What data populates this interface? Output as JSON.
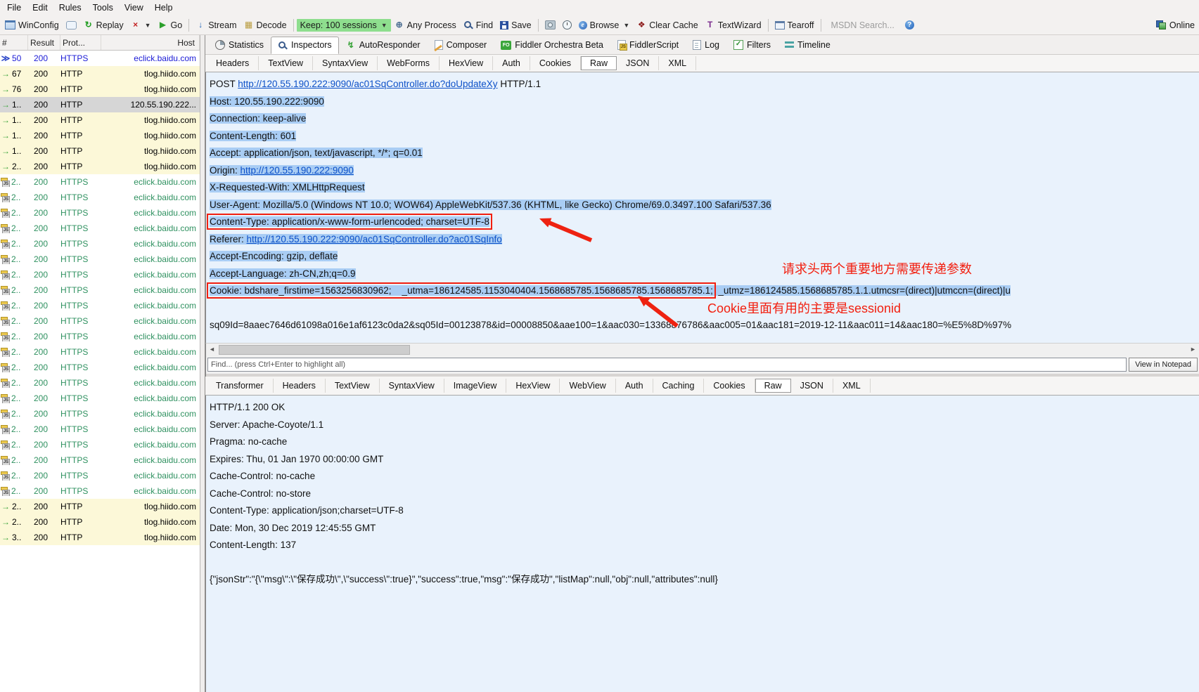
{
  "menu": {
    "items": [
      "File",
      "Edit",
      "Rules",
      "Tools",
      "View",
      "Help"
    ]
  },
  "toolbar": {
    "items": [
      {
        "type": "button",
        "icon": "winconfig-icon",
        "label": "WinConfig"
      },
      {
        "type": "button",
        "icon": "comment-icon",
        "label": ""
      },
      {
        "type": "button",
        "icon": "replay-icon",
        "label": "Replay"
      },
      {
        "type": "button",
        "icon": "remove-x-icon",
        "label": "",
        "caret": true
      },
      {
        "type": "button",
        "icon": "go-icon",
        "label": "Go"
      },
      {
        "type": "separator"
      },
      {
        "type": "button",
        "icon": "stream-icon",
        "label": "Stream"
      },
      {
        "type": "button",
        "icon": "decode-icon",
        "label": "Decode"
      },
      {
        "type": "separator"
      },
      {
        "type": "button",
        "icon": null,
        "label": "Keep: 100 sessions",
        "variant": "keep",
        "caret": true
      },
      {
        "type": "button",
        "icon": "any-process-icon",
        "label": "Any Process"
      },
      {
        "type": "button",
        "icon": "find-icon",
        "label": "Find"
      },
      {
        "type": "button",
        "icon": "save-icon",
        "label": "Save"
      },
      {
        "type": "separator"
      },
      {
        "type": "button",
        "icon": "screenshot-icon",
        "label": ""
      },
      {
        "type": "button",
        "icon": "timer-icon",
        "label": ""
      },
      {
        "type": "button",
        "icon": "browse-icon",
        "label": "Browse",
        "caret": true
      },
      {
        "type": "button",
        "icon": "clear-cache-icon",
        "label": "Clear Cache"
      },
      {
        "type": "button",
        "icon": "text-wizard-icon",
        "label": "TextWizard"
      },
      {
        "type": "separator"
      },
      {
        "type": "button",
        "icon": "tearoff-icon",
        "label": "Tearoff"
      },
      {
        "type": "separator"
      },
      {
        "type": "msdn",
        "label": "MSDN Search..."
      },
      {
        "type": "button",
        "icon": "help-icon",
        "label": ""
      }
    ],
    "online": {
      "icon": "online-icon",
      "label": "Online"
    }
  },
  "session_list": {
    "columns": [
      "#",
      "Result",
      "Prot...",
      "Host"
    ],
    "rows": [
      {
        "icon": "session-selected-icon",
        "num": "50",
        "result": "200",
        "protocol": "HTTPS",
        "host": "eclick.baidu.com",
        "style": "blue"
      },
      {
        "icon": "request-arrow-icon",
        "num": "67",
        "result": "200",
        "protocol": "HTTP",
        "host": "tlog.hiido.com",
        "style": "yellow"
      },
      {
        "icon": "request-arrow-icon",
        "num": "76",
        "result": "200",
        "protocol": "HTTP",
        "host": "tlog.hiido.com",
        "style": "yellow"
      },
      {
        "icon": "request-arrow-icon",
        "num": "1..",
        "result": "200",
        "protocol": "HTTP",
        "host": "120.55.190.222...",
        "style": "selected"
      },
      {
        "icon": "request-arrow-icon",
        "num": "1..",
        "result": "200",
        "protocol": "HTTP",
        "host": "tlog.hiido.com",
        "style": "yellow"
      },
      {
        "icon": "request-arrow-icon",
        "num": "1..",
        "result": "200",
        "protocol": "HTTP",
        "host": "tlog.hiido.com",
        "style": "yellow"
      },
      {
        "icon": "request-arrow-icon",
        "num": "1..",
        "result": "200",
        "protocol": "HTTP",
        "host": "tlog.hiido.com",
        "style": "yellow"
      },
      {
        "icon": "request-arrow-icon",
        "num": "2..",
        "result": "200",
        "protocol": "HTTP",
        "host": "tlog.hiido.com",
        "style": "yellow"
      },
      {
        "icon": "js-icon",
        "num": "2..",
        "result": "200",
        "protocol": "HTTPS",
        "host": "eclick.baidu.com",
        "style": "green"
      },
      {
        "icon": "js-icon",
        "num": "2..",
        "result": "200",
        "protocol": "HTTPS",
        "host": "eclick.baidu.com",
        "style": "green"
      },
      {
        "icon": "js-icon",
        "num": "2..",
        "result": "200",
        "protocol": "HTTPS",
        "host": "eclick.baidu.com",
        "style": "green"
      },
      {
        "icon": "js-icon",
        "num": "2..",
        "result": "200",
        "protocol": "HTTPS",
        "host": "eclick.baidu.com",
        "style": "green"
      },
      {
        "icon": "js-icon",
        "num": "2..",
        "result": "200",
        "protocol": "HTTPS",
        "host": "eclick.baidu.com",
        "style": "green"
      },
      {
        "icon": "js-icon",
        "num": "2..",
        "result": "200",
        "protocol": "HTTPS",
        "host": "eclick.baidu.com",
        "style": "green"
      },
      {
        "icon": "js-icon",
        "num": "2..",
        "result": "200",
        "protocol": "HTTPS",
        "host": "eclick.baidu.com",
        "style": "green"
      },
      {
        "icon": "js-icon",
        "num": "2..",
        "result": "200",
        "protocol": "HTTPS",
        "host": "eclick.baidu.com",
        "style": "green"
      },
      {
        "icon": "js-icon",
        "num": "2..",
        "result": "200",
        "protocol": "HTTPS",
        "host": "eclick.baidu.com",
        "style": "green"
      },
      {
        "icon": "js-icon",
        "num": "2..",
        "result": "200",
        "protocol": "HTTPS",
        "host": "eclick.baidu.com",
        "style": "green"
      },
      {
        "icon": "js-icon",
        "num": "2..",
        "result": "200",
        "protocol": "HTTPS",
        "host": "eclick.baidu.com",
        "style": "green"
      },
      {
        "icon": "js-icon",
        "num": "2..",
        "result": "200",
        "protocol": "HTTPS",
        "host": "eclick.baidu.com",
        "style": "green"
      },
      {
        "icon": "js-icon",
        "num": "2..",
        "result": "200",
        "protocol": "HTTPS",
        "host": "eclick.baidu.com",
        "style": "green"
      },
      {
        "icon": "js-icon",
        "num": "2..",
        "result": "200",
        "protocol": "HTTPS",
        "host": "eclick.baidu.com",
        "style": "green"
      },
      {
        "icon": "js-icon",
        "num": "2..",
        "result": "200",
        "protocol": "HTTPS",
        "host": "eclick.baidu.com",
        "style": "green"
      },
      {
        "icon": "js-icon",
        "num": "2..",
        "result": "200",
        "protocol": "HTTPS",
        "host": "eclick.baidu.com",
        "style": "green"
      },
      {
        "icon": "js-icon",
        "num": "2..",
        "result": "200",
        "protocol": "HTTPS",
        "host": "eclick.baidu.com",
        "style": "green"
      },
      {
        "icon": "js-icon",
        "num": "2..",
        "result": "200",
        "protocol": "HTTPS",
        "host": "eclick.baidu.com",
        "style": "green"
      },
      {
        "icon": "js-icon",
        "num": "2..",
        "result": "200",
        "protocol": "HTTPS",
        "host": "eclick.baidu.com",
        "style": "green"
      },
      {
        "icon": "js-icon",
        "num": "2..",
        "result": "200",
        "protocol": "HTTPS",
        "host": "eclick.baidu.com",
        "style": "green"
      },
      {
        "icon": "js-icon",
        "num": "2..",
        "result": "200",
        "protocol": "HTTPS",
        "host": "eclick.baidu.com",
        "style": "green"
      },
      {
        "icon": "request-arrow-icon",
        "num": "2..",
        "result": "200",
        "protocol": "HTTP",
        "host": "tlog.hiido.com",
        "style": "yellow"
      },
      {
        "icon": "request-arrow-icon",
        "num": "2..",
        "result": "200",
        "protocol": "HTTP",
        "host": "tlog.hiido.com",
        "style": "yellow"
      },
      {
        "icon": "request-arrow-icon",
        "num": "3..",
        "result": "200",
        "protocol": "HTTP",
        "host": "tlog.hiido.com",
        "style": "yellow"
      }
    ]
  },
  "main_tabs": [
    {
      "icon": "statistics-icon",
      "label": "Statistics",
      "active": false
    },
    {
      "icon": "inspectors-icon",
      "label": "Inspectors",
      "active": true
    },
    {
      "icon": "autoresponder-icon",
      "label": "AutoResponder",
      "active": false
    },
    {
      "icon": "composer-icon",
      "label": "Composer",
      "active": false
    },
    {
      "icon": "orchestra-icon",
      "label": "Fiddler Orchestra Beta",
      "active": false
    },
    {
      "icon": "fiddlerscript-icon",
      "label": "FiddlerScript",
      "active": false
    },
    {
      "icon": "log-icon",
      "label": "Log",
      "active": false
    },
    {
      "icon": "filters-icon",
      "label": "Filters",
      "active": false
    },
    {
      "icon": "timeline-icon",
      "label": "Timeline",
      "active": false
    }
  ],
  "request_inspector": {
    "tabs": [
      {
        "label": "Headers"
      },
      {
        "label": "TextView"
      },
      {
        "label": "SyntaxView"
      },
      {
        "label": "WebForms"
      },
      {
        "label": "HexView"
      },
      {
        "label": "Auth"
      },
      {
        "label": "Cookies"
      },
      {
        "label": "Raw",
        "active": true
      },
      {
        "label": "JSON"
      },
      {
        "label": "XML"
      }
    ],
    "raw_lines": [
      {
        "hl": false,
        "segments": [
          {
            "text": "POST "
          },
          {
            "text": "http://120.55.190.222:9090/ac01SqController.do?doUpdateXy",
            "link": true
          },
          {
            "text": " HTTP/1.1"
          }
        ]
      },
      {
        "hl": true,
        "segments": [
          {
            "text": "Host: 120.55.190.222:9090"
          }
        ]
      },
      {
        "hl": true,
        "segments": [
          {
            "text": "Connection: keep-alive"
          }
        ]
      },
      {
        "hl": true,
        "segments": [
          {
            "text": "Content-Length: 601"
          }
        ]
      },
      {
        "hl": true,
        "segments": [
          {
            "text": "Accept: application/json, text/javascript, */*; q=0.01"
          }
        ]
      },
      {
        "hl": true,
        "segments": [
          {
            "text": "Origin: "
          },
          {
            "text": "http://120.55.190.222:9090",
            "link": true
          }
        ]
      },
      {
        "hl": true,
        "segments": [
          {
            "text": "X-Requested-With: XMLHttpRequest"
          }
        ]
      },
      {
        "hl": true,
        "segments": [
          {
            "text": "User-Agent: Mozilla/5.0 (Windows NT 10.0; WOW64) AppleWebKit/537.36 (KHTML, like Gecko) Chrome/69.0.3497.100 Safari/537.36"
          }
        ]
      },
      {
        "hl": true,
        "segments": [
          {
            "text": "Content-Type: application/x-www-form-urlencoded; charset=UTF-8",
            "boxed": true
          }
        ]
      },
      {
        "hl": true,
        "segments": [
          {
            "text": "Referer: "
          },
          {
            "text": "http://120.55.190.222:9090/ac01SqController.do?ac01SqInfo",
            "link": true
          }
        ]
      },
      {
        "hl": true,
        "segments": [
          {
            "text": "Accept-Encoding: gzip, deflate"
          }
        ]
      },
      {
        "hl": true,
        "segments": [
          {
            "text": "Accept-Language: zh-CN,zh;q=0.9"
          }
        ]
      },
      {
        "hl": true,
        "segments": [
          {
            "text": "Cookie: bdshare_firstime=1563256830962;    _utma=186124585.1153040404.1568685785.1568685785.1568685785.1;",
            "boxed": true
          },
          {
            "text": "  _utmz=186124585.1568685785.1.1.utmcsr=(direct)|utmccn=(direct)|u"
          }
        ]
      },
      {
        "hl": false,
        "segments": []
      },
      {
        "hl": false,
        "segments": [
          {
            "text": "sq09Id=8aaec7646d61098a016e1af6123c0da2&sq05Id=00123878&id=00008850&aae100=1&aac030=13368876786&aac005=01&aac181=2019-12-11&aac011=14&aac180=%E5%8D%97%"
          }
        ]
      }
    ],
    "annotations": [
      {
        "text": "请求头两个重要地方需要传递参数"
      },
      {
        "text": "Cookie里面有用的主要是sessionid"
      }
    ]
  },
  "find_bar": {
    "placeholder": "Find... (press Ctrl+Enter to highlight all)",
    "view_in_notepad_label": "View in Notepad"
  },
  "response_inspector": {
    "tabs": [
      {
        "label": "Transformer"
      },
      {
        "label": "Headers"
      },
      {
        "label": "TextView"
      },
      {
        "label": "SyntaxView"
      },
      {
        "label": "ImageView"
      },
      {
        "label": "HexView"
      },
      {
        "label": "WebView"
      },
      {
        "label": "Auth"
      },
      {
        "label": "Caching"
      },
      {
        "label": "Cookies"
      },
      {
        "label": "Raw",
        "active": true
      },
      {
        "label": "JSON"
      },
      {
        "label": "XML"
      }
    ],
    "raw_lines": [
      {
        "hl": false,
        "segments": [
          {
            "text": "HTTP/1.1 200 OK"
          }
        ]
      },
      {
        "hl": false,
        "segments": [
          {
            "text": "Server: Apache-Coyote/1.1"
          }
        ]
      },
      {
        "hl": false,
        "segments": [
          {
            "text": "Pragma: no-cache"
          }
        ]
      },
      {
        "hl": false,
        "segments": [
          {
            "text": "Expires: Thu, 01 Jan 1970 00:00:00 GMT"
          }
        ]
      },
      {
        "hl": false,
        "segments": [
          {
            "text": "Cache-Control: no-cache"
          }
        ]
      },
      {
        "hl": false,
        "segments": [
          {
            "text": "Cache-Control: no-store"
          }
        ]
      },
      {
        "hl": false,
        "segments": [
          {
            "text": "Content-Type: application/json;charset=UTF-8"
          }
        ]
      },
      {
        "hl": false,
        "segments": [
          {
            "text": "Date: Mon, 30 Dec 2019 12:45:55 GMT"
          }
        ]
      },
      {
        "hl": false,
        "segments": [
          {
            "text": "Content-Length: 137"
          }
        ]
      },
      {
        "hl": false,
        "segments": []
      },
      {
        "hl": false,
        "segments": [
          {
            "text": "{\"jsonStr\":\"{\\\"msg\\\":\\\"保存成功\\\",\\\"success\\\":true}\",\"success\":true,\"msg\":\"保存成功\",\"listMap\":null,\"obj\":null,\"attributes\":null}"
          }
        ]
      }
    ]
  }
}
